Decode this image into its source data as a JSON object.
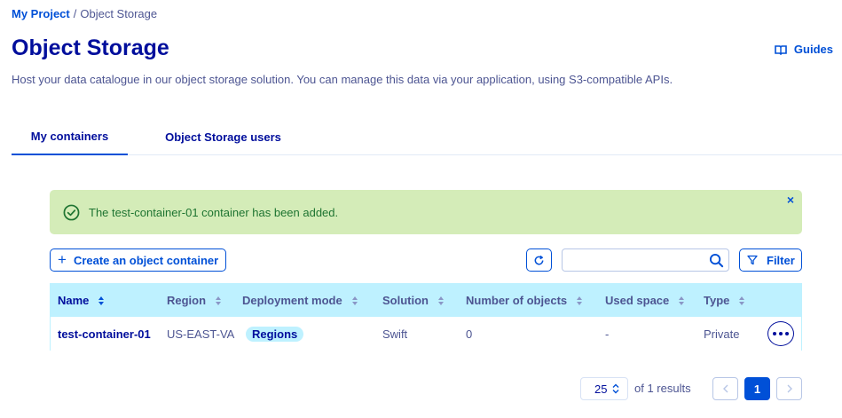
{
  "breadcrumb": {
    "project": "My Project",
    "separator": "/",
    "current": "Object Storage"
  },
  "header": {
    "title": "Object Storage",
    "guides_label": "Guides",
    "guides_icon": "book-icon",
    "subtitle": "Host your data catalogue in our object storage solution. You can manage this data via your application, using S3-compatible APIs."
  },
  "tabs": [
    {
      "label": "My containers",
      "active": true
    },
    {
      "label": "Object Storage users",
      "active": false
    }
  ],
  "alert": {
    "message": "The test-container-01 container has been added.",
    "close": "×",
    "icon": "check-circle-icon",
    "color": "#1e7431",
    "background": "#d4ecb8"
  },
  "toolbar": {
    "create_plus": "+",
    "create_label": "Create an object container",
    "refresh_icon": "refresh-icon",
    "search_value": "",
    "search_icon": "search-icon",
    "filter_label": "Filter",
    "filter_icon": "funnel-icon"
  },
  "table": {
    "columns": [
      "Name",
      "Region",
      "Deployment mode",
      "Solution",
      "Number of objects",
      "Used space",
      "Type"
    ],
    "rows": [
      {
        "name": "test-container-01",
        "region": "US-EAST-VA",
        "deployment_mode": "Regions",
        "solution": "Swift",
        "objects": "0",
        "used_space": "-",
        "type": "Private"
      }
    ],
    "header_color": "#bef1ff"
  },
  "pagination": {
    "page_size": "25",
    "results_text": "of 1 results",
    "current_page": "1"
  },
  "colors": {
    "primary": "#0050d7",
    "heading": "#000e9c",
    "text": "#4d5592"
  }
}
